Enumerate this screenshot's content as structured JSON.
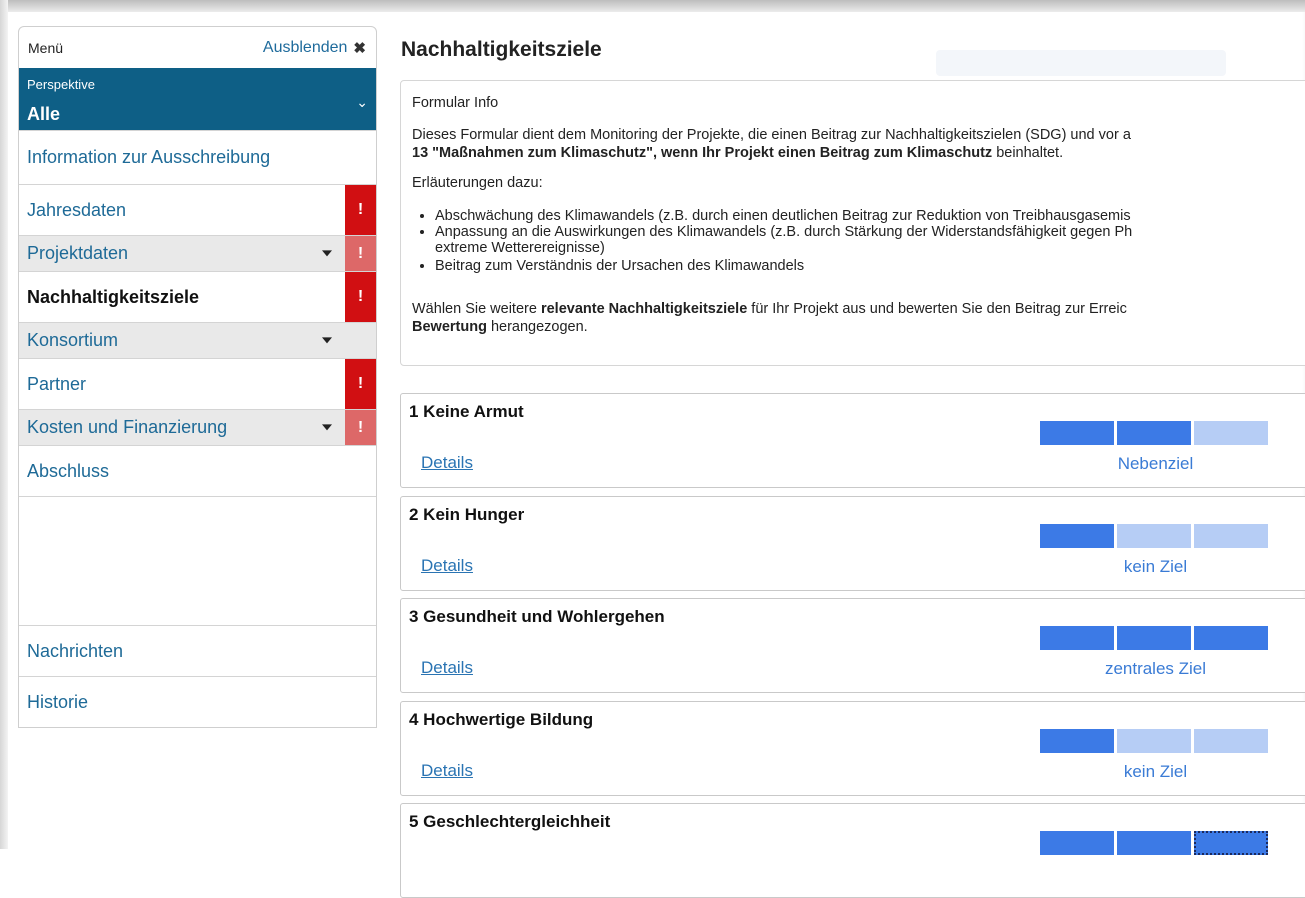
{
  "sidebar": {
    "menu_label": "Menü",
    "hide_label": "Ausblenden",
    "hide_icon": "close-icon",
    "perspective": {
      "label": "Perspektive",
      "value": "Alle"
    },
    "items": [
      {
        "label": "Information zur Ausschreibung"
      },
      {
        "label": "Jahresdaten",
        "alert": "!"
      },
      {
        "label": "Projektdaten",
        "alert": "!"
      },
      {
        "label": "Nachhaltigkeitsziele",
        "alert": "!"
      },
      {
        "label": "Konsortium"
      },
      {
        "label": "Partner",
        "alert": "!"
      },
      {
        "label": "Kosten und Finanzierung",
        "alert": "!"
      },
      {
        "label": "Abschluss"
      },
      {
        "label": "Nachrichten"
      },
      {
        "label": "Historie"
      }
    ]
  },
  "main": {
    "title": "Nachhaltigkeitsziele",
    "info": {
      "heading": "Formular Info",
      "p1a": "Dieses Formular dient dem Monitoring der Projekte, die einen Beitrag zur Nachhaltigkeitszielen (SDG) und vor a",
      "p1b_bold": "13 \"Maßnahmen zum Klimaschutz\", wenn Ihr Projekt einen Beitrag zum Klimaschutz",
      "p1b_rest": " beinhaltet.",
      "explain": "Erläuterungen dazu:",
      "bullet1": "Abschwächung des Klimawandels (z.B. durch einen deutlichen Beitrag zur Reduktion von Treibhausgasemis",
      "bullet2a": "Anpassung an die Auswirkungen des Klimawandels (z.B. durch Stärkung der Widerstandsfähigkeit gegen Ph",
      "bullet2b": "extreme Wetterereignisse)",
      "bullet3": "Beitrag zum Verständnis der Ursachen des Klimawandels",
      "p2a_pre": "Wählen Sie weitere ",
      "p2a_bold": "relevante Nachhaltigkeitsziele",
      "p2a_post": " für Ihr Projekt aus und bewerten Sie den Beitrag zur Erreic",
      "p2b_bold": "Bewertung",
      "p2b_post": " herangezogen."
    },
    "goals": [
      {
        "title": "1 Keine Armut",
        "details": "Details",
        "status": "Nebenziel",
        "level": 2
      },
      {
        "title": "2 Kein Hunger",
        "details": "Details",
        "status": "kein Ziel",
        "level": 1
      },
      {
        "title": "3 Gesundheit und Wohlergehen",
        "details": "Details",
        "status": "zentrales Ziel",
        "level": 3
      },
      {
        "title": "4 Hochwertige Bildung",
        "details": "Details",
        "status": "kein Ziel",
        "level": 1
      },
      {
        "title": "5 Geschlechtergleichheit",
        "details": "",
        "status": "",
        "level": 3
      }
    ]
  }
}
